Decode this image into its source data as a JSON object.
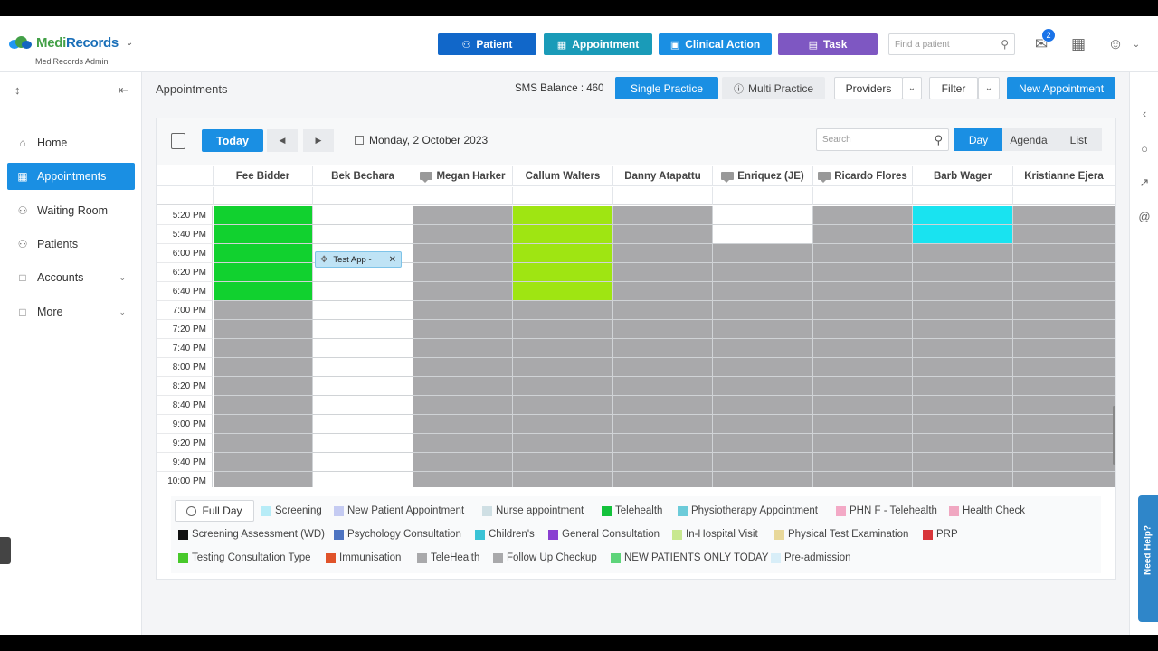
{
  "header": {
    "logo_prefix": "Medi",
    "logo_suffix": "Records",
    "logo_sub": "MediRecords Admin",
    "buttons": [
      {
        "label": "Patient",
        "icon": "person-plus-icon",
        "color": "#1167c9"
      },
      {
        "label": "Appointment",
        "icon": "calendar-plus-icon",
        "color": "#1a9bb8"
      },
      {
        "label": "Clinical Action",
        "icon": "clinical-icon",
        "color": "#1a8fe3"
      },
      {
        "label": "Task",
        "icon": "clipboard-icon",
        "color": "#7e57c2"
      }
    ],
    "find_placeholder": "Find a patient",
    "mail_badge": "2"
  },
  "sidebar": {
    "items": [
      {
        "label": "Home",
        "icon": "home-icon",
        "active": false
      },
      {
        "label": "Appointments",
        "icon": "calendar-icon",
        "active": true
      },
      {
        "label": "Waiting Room",
        "icon": "waiting-room-icon",
        "active": false
      },
      {
        "label": "Patients",
        "icon": "patients-icon",
        "active": false
      },
      {
        "label": "Accounts",
        "icon": "folder-icon",
        "active": false,
        "caret": true
      },
      {
        "label": "More",
        "icon": "more-icon",
        "active": false,
        "caret": true
      }
    ]
  },
  "toolbar": {
    "title": "Appointments",
    "sms_balance": "SMS Balance : 460",
    "single_practice": "Single Practice",
    "multi_practice": "Multi Practice",
    "providers": "Providers",
    "filter": "Filter",
    "new_appointment": "New Appointment"
  },
  "calendar": {
    "today": "Today",
    "date": "Monday, 2 October 2023",
    "search_placeholder": "Search",
    "views": [
      "Day",
      "Agenda",
      "List"
    ],
    "active_view": "Day",
    "providers": [
      {
        "name": "Fee Bidder",
        "chat": false
      },
      {
        "name": "Bek Bechara",
        "chat": false
      },
      {
        "name": "Megan Harker",
        "chat": true
      },
      {
        "name": "Callum Walters",
        "chat": false
      },
      {
        "name": "Danny Atapattu",
        "chat": false
      },
      {
        "name": "Enriquez (JE)",
        "chat": true
      },
      {
        "name": "Ricardo Flores",
        "chat": true
      },
      {
        "name": "Barb Wager",
        "chat": false
      },
      {
        "name": "Kristianne Ejera",
        "chat": false
      }
    ],
    "times": [
      "5:20 PM",
      "5:40 PM",
      "6:00 PM",
      "6:20 PM",
      "6:40 PM",
      "7:00 PM",
      "7:20 PM",
      "7:40 PM",
      "8:00 PM",
      "8:20 PM",
      "8:40 PM",
      "9:00 PM",
      "9:20 PM",
      "9:40 PM",
      "10:00 PM"
    ],
    "slot_colors": [
      [
        "#11d12f",
        "#ffffff",
        "#a9a9ab",
        "#9fe512",
        "#a9a9ab",
        "#ffffff",
        "#a9a9ab",
        "#19e3f0",
        "#a9a9ab"
      ],
      [
        "#11d12f",
        "#ffffff",
        "#a9a9ab",
        "#9fe512",
        "#a9a9ab",
        "#ffffff",
        "#a9a9ab",
        "#19e3f0",
        "#a9a9ab"
      ],
      [
        "#11d12f",
        "#ffffff",
        "#a9a9ab",
        "#9fe512",
        "#a9a9ab",
        "#a9a9ab",
        "#a9a9ab",
        "#a9a9ab",
        "#a9a9ab"
      ],
      [
        "#11d12f",
        "#ffffff",
        "#a9a9ab",
        "#9fe512",
        "#a9a9ab",
        "#a9a9ab",
        "#a9a9ab",
        "#a9a9ab",
        "#a9a9ab"
      ],
      [
        "#11d12f",
        "#ffffff",
        "#a9a9ab",
        "#9fe512",
        "#a9a9ab",
        "#a9a9ab",
        "#a9a9ab",
        "#a9a9ab",
        "#a9a9ab"
      ],
      [
        "#a9a9ab",
        "#ffffff",
        "#a9a9ab",
        "#a9a9ab",
        "#a9a9ab",
        "#a9a9ab",
        "#a9a9ab",
        "#a9a9ab",
        "#a9a9ab"
      ],
      [
        "#a9a9ab",
        "#ffffff",
        "#a9a9ab",
        "#a9a9ab",
        "#a9a9ab",
        "#a9a9ab",
        "#a9a9ab",
        "#a9a9ab",
        "#a9a9ab"
      ],
      [
        "#a9a9ab",
        "#ffffff",
        "#a9a9ab",
        "#a9a9ab",
        "#a9a9ab",
        "#a9a9ab",
        "#a9a9ab",
        "#a9a9ab",
        "#a9a9ab"
      ],
      [
        "#a9a9ab",
        "#ffffff",
        "#a9a9ab",
        "#a9a9ab",
        "#a9a9ab",
        "#a9a9ab",
        "#a9a9ab",
        "#a9a9ab",
        "#a9a9ab"
      ],
      [
        "#a9a9ab",
        "#ffffff",
        "#a9a9ab",
        "#a9a9ab",
        "#a9a9ab",
        "#a9a9ab",
        "#a9a9ab",
        "#a9a9ab",
        "#a9a9ab"
      ],
      [
        "#a9a9ab",
        "#ffffff",
        "#a9a9ab",
        "#a9a9ab",
        "#a9a9ab",
        "#a9a9ab",
        "#a9a9ab",
        "#a9a9ab",
        "#a9a9ab"
      ],
      [
        "#a9a9ab",
        "#ffffff",
        "#a9a9ab",
        "#a9a9ab",
        "#a9a9ab",
        "#a9a9ab",
        "#a9a9ab",
        "#a9a9ab",
        "#a9a9ab"
      ],
      [
        "#a9a9ab",
        "#ffffff",
        "#a9a9ab",
        "#a9a9ab",
        "#a9a9ab",
        "#a9a9ab",
        "#a9a9ab",
        "#a9a9ab",
        "#a9a9ab"
      ],
      [
        "#a9a9ab",
        "#ffffff",
        "#a9a9ab",
        "#a9a9ab",
        "#a9a9ab",
        "#a9a9ab",
        "#a9a9ab",
        "#a9a9ab",
        "#a9a9ab"
      ],
      [
        "#a9a9ab",
        "#ffffff",
        "#a9a9ab",
        "#a9a9ab",
        "#a9a9ab",
        "#a9a9ab",
        "#a9a9ab",
        "#a9a9ab",
        "#a9a9ab"
      ]
    ],
    "appointment": {
      "label": "Test App -",
      "provider": "Bek Bechara",
      "time": "6:00 PM"
    }
  },
  "legend": {
    "full_day": "Full Day",
    "rows": [
      [
        {
          "label": "Screening",
          "color": "#b7ecf7"
        },
        {
          "label": "New Patient Appointment",
          "color": "#c5cbf2"
        },
        {
          "label": "Nurse appointment",
          "color": "#cfdfe4"
        },
        {
          "label": "Telehealth",
          "color": "#14c23c"
        },
        {
          "label": "Physiotherapy Appointment",
          "color": "#6ccbd9"
        },
        {
          "label": "PHN F - Telehealth",
          "color": "#f3a9c6"
        },
        {
          "label": "Health Check",
          "color": "#f0a7c1"
        }
      ],
      [
        {
          "label": "Screening Assessment (WD)",
          "color": "#111111"
        },
        {
          "label": "Psychology Consultation",
          "color": "#4e74c2"
        },
        {
          "label": "Children's",
          "color": "#3ac3d6"
        },
        {
          "label": "General Consultation",
          "color": "#8a3fd1"
        },
        {
          "label": "In-Hospital Visit",
          "color": "#c8e88f"
        },
        {
          "label": "Physical Test Examination",
          "color": "#e8d89a"
        },
        {
          "label": "PRP",
          "color": "#d8353a"
        }
      ],
      [
        {
          "label": "Testing Consultation Type",
          "color": "#48c92b"
        },
        {
          "label": "Immunisation",
          "color": "#e0532a"
        },
        {
          "label": "TeleHealth",
          "color": "#a9a9ab"
        },
        {
          "label": "Follow Up Checkup",
          "color": "#a9a9ab"
        },
        {
          "label": "NEW PATIENTS ONLY TODAY",
          "color": "#5ed47a"
        },
        {
          "label": "Pre-admission",
          "color": "#d8eef8"
        }
      ]
    ]
  },
  "help": {
    "label": "Need Help?"
  }
}
